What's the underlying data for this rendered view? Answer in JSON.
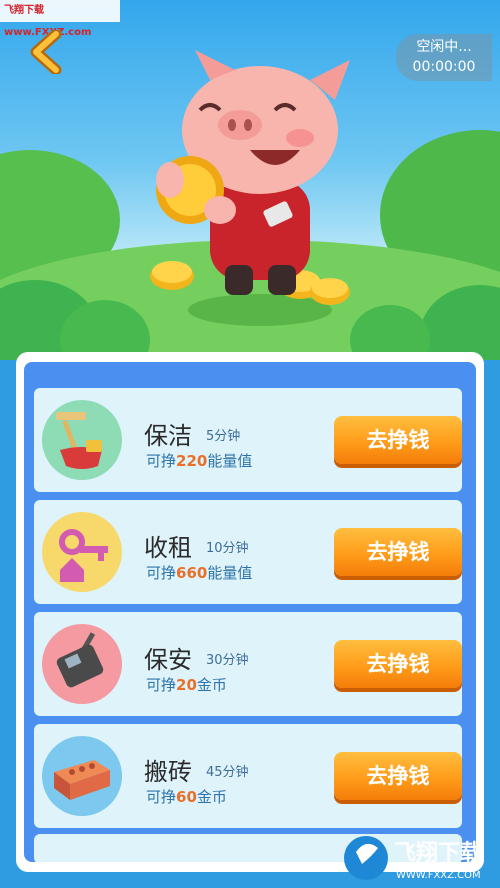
{
  "watermark": "飞翔下载 www.FXXZ.com",
  "status": {
    "label": "空闲中...",
    "timer": "00:00:00"
  },
  "jobs": [
    {
      "title": "保洁",
      "duration": "5分钟",
      "reward_prefix": "可挣",
      "reward_amount": "220",
      "reward_unit": "能量值",
      "button": "去挣钱",
      "icon": "broom-bucket-icon"
    },
    {
      "title": "收租",
      "duration": "10分钟",
      "reward_prefix": "可挣",
      "reward_amount": "660",
      "reward_unit": "能量值",
      "button": "去挣钱",
      "icon": "house-key-icon"
    },
    {
      "title": "保安",
      "duration": "30分钟",
      "reward_prefix": "可挣",
      "reward_amount": "20",
      "reward_unit": "金币",
      "button": "去挣钱",
      "icon": "walkie-talkie-icon"
    },
    {
      "title": "搬砖",
      "duration": "45分钟",
      "reward_prefix": "可挣",
      "reward_amount": "60",
      "reward_unit": "金币",
      "button": "去挣钱",
      "icon": "brick-icon"
    }
  ],
  "colors": {
    "button": "#ff9c1a",
    "card": "#dff3fb",
    "panel": "#4b8ff0",
    "reward_amount": "#e8702a"
  },
  "logo": {
    "text": "飞翔下载",
    "url_text": "WWW.FXXZ.COM"
  }
}
